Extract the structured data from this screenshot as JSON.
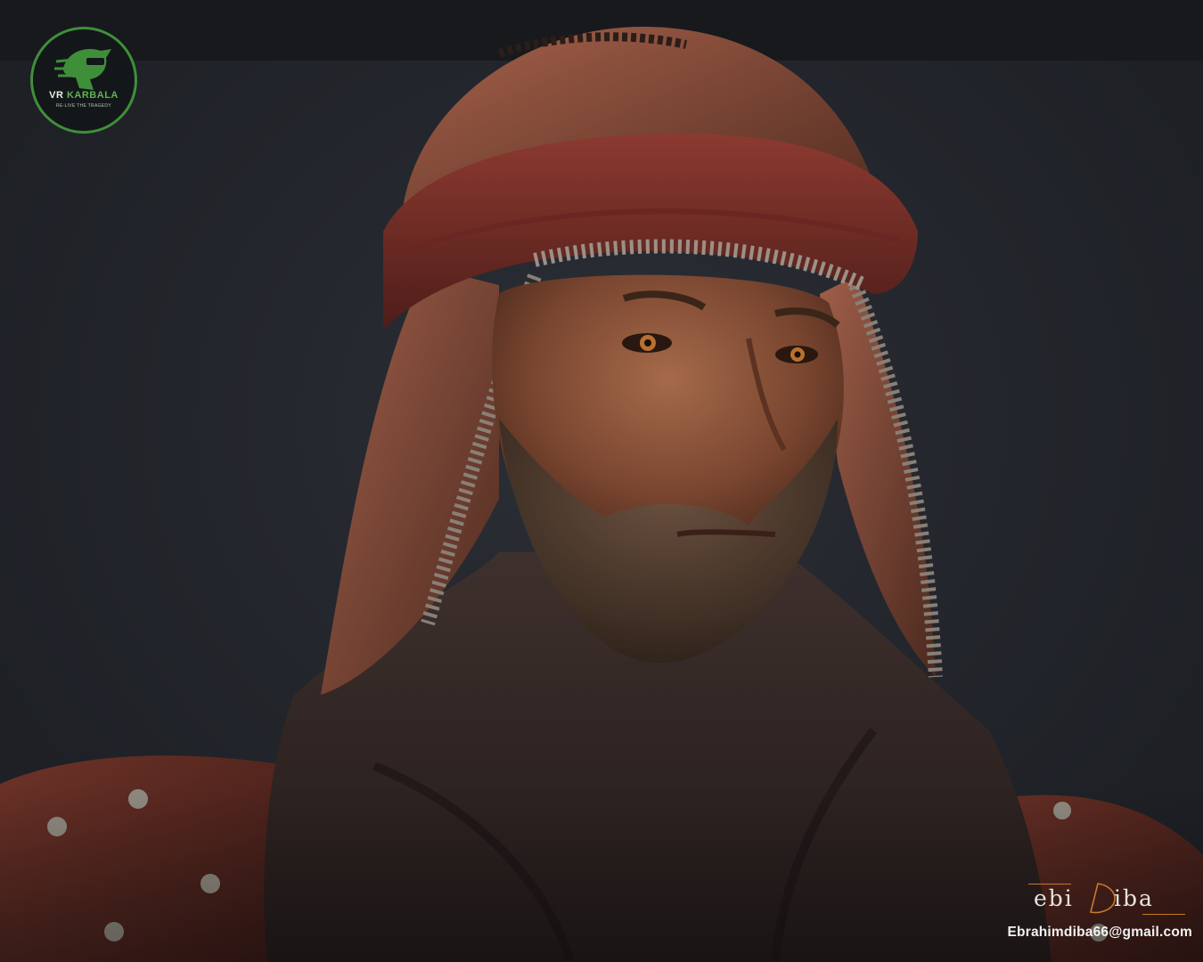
{
  "logo": {
    "title_main": "VR ",
    "title_accent": "KARBALA",
    "tagline": "RE-LIVE THE TRAGEDY",
    "icon": "helmet-head-icon",
    "colors": {
      "ring": "#3f8f3a",
      "accent": "#5db34f"
    }
  },
  "signature": {
    "left": "ebi",
    "right": "iba",
    "accent_color": "#c47a2a"
  },
  "contact": {
    "email": "Ebrahimdiba66@gmail.com"
  }
}
